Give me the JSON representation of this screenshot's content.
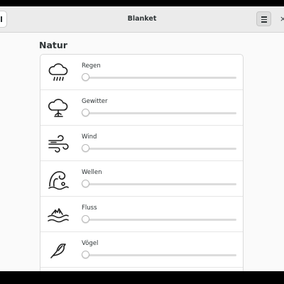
{
  "window": {
    "title": "Blanket"
  },
  "headerbar": {
    "menu_icon": "hamburger-menu-icon",
    "close_label": "×",
    "play_icon": "pause-icon"
  },
  "section": {
    "title": "Natur"
  },
  "sounds": [
    {
      "label": "Regen",
      "icon": "rain-icon",
      "volume": 0
    },
    {
      "label": "Gewitter",
      "icon": "storm-icon",
      "volume": 0
    },
    {
      "label": "Wind",
      "icon": "wind-icon",
      "volume": 0
    },
    {
      "label": "Wellen",
      "icon": "waves-icon",
      "volume": 0
    },
    {
      "label": "Fluss",
      "icon": "stream-icon",
      "volume": 0
    },
    {
      "label": "Vögel",
      "icon": "birds-icon",
      "volume": 0
    }
  ],
  "colors": {
    "window_bg": "#fafafa",
    "headerbar_bg": "#ebebeb",
    "text": "#2e3436"
  }
}
